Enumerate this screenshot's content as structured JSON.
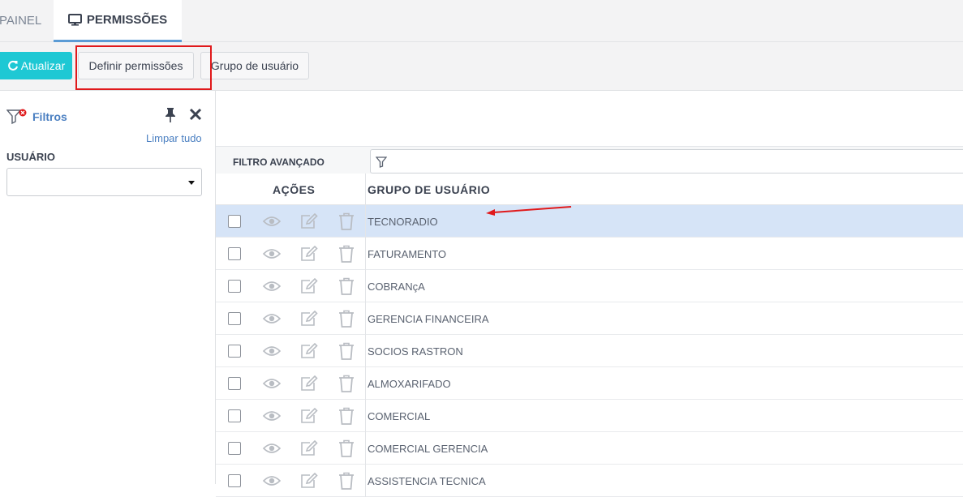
{
  "tabs": {
    "painel": "PAINEL",
    "permissoes": "PERMISSÕES"
  },
  "toolbar": {
    "refresh_label": "Atualizar",
    "define_label": "Definir permissões",
    "group_label": "Grupo de usuário"
  },
  "filters": {
    "title": "Filtros",
    "clear_all": "Limpar tudo",
    "user_label": "USUÁRIO",
    "user_value": ""
  },
  "advanced_filter": {
    "label": "FILTRO AVANÇADO",
    "value": ""
  },
  "table": {
    "col_actions": "AÇÕES",
    "col_group": "GRUPO DE USUÁRIO",
    "rows": [
      {
        "name": "TECNORADIO",
        "selected": true
      },
      {
        "name": "FATURAMENTO",
        "selected": false
      },
      {
        "name": "COBRANçA",
        "selected": false
      },
      {
        "name": "GERENCIA FINANCEIRA",
        "selected": false
      },
      {
        "name": "SOCIOS RASTRON",
        "selected": false
      },
      {
        "name": "ALMOXARIFADO",
        "selected": false
      },
      {
        "name": "COMERCIAL",
        "selected": false
      },
      {
        "name": "COMERCIAL GERENCIA",
        "selected": false
      },
      {
        "name": "ASSISTENCIA TECNICA",
        "selected": false
      }
    ]
  },
  "colors": {
    "accent": "#1ec8d4",
    "link": "#4a7fc1",
    "selected_row": "#d6e4f7",
    "highlight": "#e0191b"
  }
}
